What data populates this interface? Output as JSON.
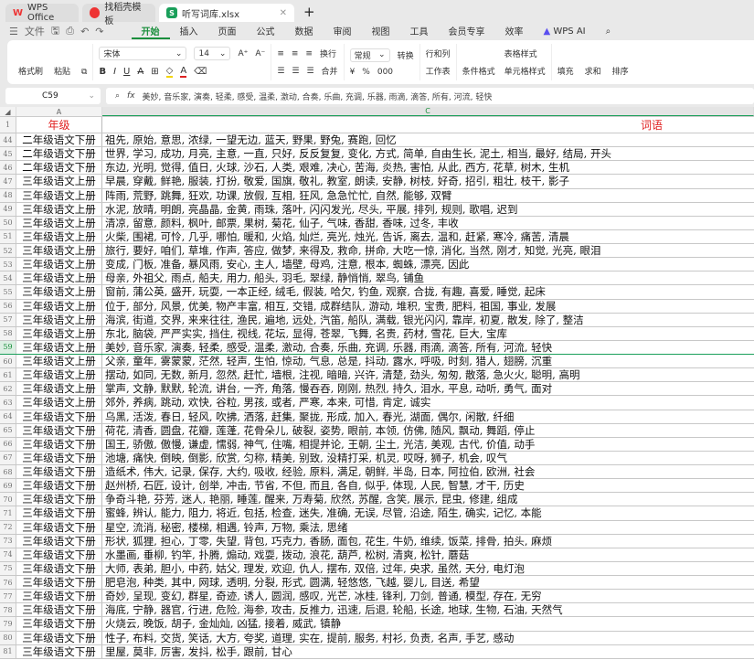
{
  "tabs": [
    {
      "label": "WPS Office",
      "icon": "wps-logo-icon"
    },
    {
      "label": "找稻壳模板",
      "icon": "docer-icon"
    },
    {
      "label": "听写词库.xlsx",
      "icon": "spreadsheet-icon"
    }
  ],
  "menu": {
    "file": "文件",
    "items": [
      "开始",
      "插入",
      "页面",
      "公式",
      "数据",
      "审阅",
      "视图",
      "工具",
      "会员专享",
      "效率"
    ],
    "active": "开始",
    "ai": "WPS AI"
  },
  "ribbon": {
    "format_painter": "格式刷",
    "paste": "粘贴",
    "font": "宋体",
    "font_size": "14",
    "wrap": "换行",
    "merge": "合并",
    "number_format": "常规",
    "convert": "转换",
    "rows_cols": "行和列",
    "worksheet": "工作表",
    "cond_format": "条件格式",
    "table_style": "表格样式",
    "cell_style": "单元格样式",
    "fill": "填充",
    "sum": "求和",
    "sort": "排序"
  },
  "formula_bar": {
    "cell_ref": "C59",
    "fx": "fx",
    "value": "美妙, 音乐家, 演奏, 轻柔, 感受, 温柔, 激动, 合奏, 乐曲, 充调, 乐器, 雨滴, 滴答, 所有, 河流, 轻快"
  },
  "columns": {
    "a": "A",
    "c": "C"
  },
  "header_row": {
    "num": "1",
    "a": "年级",
    "c": "词语"
  },
  "selected_row": "59",
  "colors": {
    "accent": "#1a8f3c",
    "header_text": "#e02020"
  },
  "rows": [
    {
      "n": "44",
      "a": "二年级语文下册",
      "c": "祖先, 原始, 意思, 浓绿, 一望无边, 蓝天, 野果, 野兔, 赛跑, 回忆"
    },
    {
      "n": "45",
      "a": "二年级语文下册",
      "c": "世界, 学习, 成功, 月亮, 主意, 一直, 只好, 反反复复, 变化, 方式, 简单, 自由生长, 泥土, 相当, 最好, 结局, 开头"
    },
    {
      "n": "46",
      "a": "二年级语文下册",
      "c": "东边, 光明, 觉得, 值日, 火球, 沙石, 人类, 艰难, 决心, 苦海, 炎热, 害怕, 从此, 西方, 花草, 树木, 生机"
    },
    {
      "n": "47",
      "a": "三年级语文上册",
      "c": "早晨, 穿戴, 鲜艳, 服装, 打扮, 敬爱, 国旗, 敬礼, 教室, 朗读, 安静, 树枝, 好奇, 招引, 粗壮, 枝干, 影子"
    },
    {
      "n": "48",
      "a": "三年级语文上册",
      "c": "阵雨, 荒野, 跳舞, 狂欢, 功课, 放假, 互相, 狂风, 急急忙忙, 自然, 能够, 双臂"
    },
    {
      "n": "49",
      "a": "三年级语文上册",
      "c": "水泥, 放晴, 明朗, 亮晶晶, 金黄, 雨珠, 落叶, 闪闪发光, 尽头, 平展, 排列, 规则, 歌唱, 迟到"
    },
    {
      "n": "50",
      "a": "三年级语文上册",
      "c": "清凉, 留意, 颜料, 枫叶, 邮票, 果树, 菊花, 仙子, 气味, 香甜, 香味, 过冬, 丰收"
    },
    {
      "n": "51",
      "a": "三年级语文上册",
      "c": "火柴, 围裙, 可怜, 几乎, 哪怕, 暖和, 火焰, 灿烂, 亮光, 烛光, 告诉, 离去, 温和, 赶紧, 寒冷, 痛苦, 清晨"
    },
    {
      "n": "52",
      "a": "三年级语文上册",
      "c": "旅行, 要好, 咱们, 草堆, 作声, 答应, 做梦, 来得及, 救命, 拼命, 大吃一惊, 消化, 当然, 刚才, 知觉, 光亮, 眼泪"
    },
    {
      "n": "53",
      "a": "三年级语文上册",
      "c": "变成, 门板, 准备, 暴风雨, 安心, 主人, 墙壁, 母鸡, 注意, 根本, 蜘蛛, 漂亮, 因此"
    },
    {
      "n": "54",
      "a": "三年级语文上册",
      "c": "母亲, 外祖父, 雨点, 船夫, 用力, 船头, 羽毛, 翠绿, 静悄悄, 翠鸟, 铺鱼"
    },
    {
      "n": "55",
      "a": "三年级语文上册",
      "c": "窗前, 蒲公英, 盛开, 玩耍, 一本正经, 绒毛, 假装, 哈欠, 钓鱼, 观察, 合拢, 有趣, 喜爱, 睡觉, 起床"
    },
    {
      "n": "56",
      "a": "三年级语文上册",
      "c": "位于, 部分, 风景, 优美, 物产丰富, 相互, 交错, 成群结队, 游动, 堆积, 宝贵, 肥料, 祖国, 事业, 发展"
    },
    {
      "n": "57",
      "a": "三年级语文上册",
      "c": "海滨, 街道, 交界, 来来往往, 渔民, 遍地, 远处, 汽笛, 船队, 满载, 银光闪闪, 靠岸, 初夏, 散发, 除了, 整洁"
    },
    {
      "n": "58",
      "a": "三年级语文上册",
      "c": "东北, 脑袋, 严严实实, 挡住, 视线, 花坛, 显得, 苍翠, 飞舞, 名贵, 药材, 雪花, 巨大, 宝库"
    },
    {
      "n": "59",
      "a": "三年级语文上册",
      "c": "美妙, 音乐家, 演奏, 轻柔, 感受, 温柔, 激动, 合奏, 乐曲, 充调, 乐器, 雨滴, 滴答, 所有, 河流, 轻快"
    },
    {
      "n": "60",
      "a": "三年级语文上册",
      "c": "父亲, 童年, 雾蒙蒙, 茫然, 轻声, 生怕, 惊动, 气息, 总是, 抖动, 露水, 呼吸, 时刻, 猎人, 翅膀, 沉重"
    },
    {
      "n": "61",
      "a": "三年级语文上册",
      "c": "摆动, 如同, 无数, 新月, 忽然, 赶忙, 墙根, 注视, 暗暗, 兴许, 清楚, 劲头, 匆匆, 散落, 急火火, 聪明, 高明"
    },
    {
      "n": "62",
      "a": "三年级语文上册",
      "c": "掌声, 文静, 默默, 轮流, 讲台, 一齐, 角落, 慢吞吞, 刚刚, 热烈, 持久, 泪水, 平息, 动听, 勇气, 面对"
    },
    {
      "n": "63",
      "a": "三年级语文上册",
      "c": "郊外, 养病, 跳动, 欢快, 谷粒, 男孩, 或者, 严寒, 本来, 可惜, 肯定, 诚实"
    },
    {
      "n": "64",
      "a": "三年级语文下册",
      "c": "乌黑, 活泼, 春日, 轻风, 吹拂, 洒落, 赶集, 聚拢, 形成, 加入, 春光, 湖面, 偶尔, 闲散, 纤细"
    },
    {
      "n": "65",
      "a": "三年级语文下册",
      "c": "荷花, 清香, 圆盘, 花瓣, 莲蓬, 花骨朵儿, 破裂, 姿势, 眼前, 本领, 仿佛, 随风, 飘动, 舞蹈, 停止"
    },
    {
      "n": "66",
      "a": "三年级语文下册",
      "c": "国王, 骄傲, 傲慢, 谦虚, 懦弱, 神气, 住嘴, 相提并论, 王朝, 尘土, 光洁, 美观, 古代, 价值, 动手"
    },
    {
      "n": "67",
      "a": "三年级语文下册",
      "c": "池塘, 痛快, 倒映, 倒影, 欣赏, 匀称, 精美, 别致, 没精打采, 机灵, 哎呀, 狮子, 机会, 叹气"
    },
    {
      "n": "68",
      "a": "三年级语文下册",
      "c": "造纸术, 伟大, 记录, 保存, 大约, 吸收, 经验, 原料, 满足, 朝鲜, 半岛, 日本, 阿拉伯, 欧洲, 社会"
    },
    {
      "n": "69",
      "a": "三年级语文下册",
      "c": "赵州桥, 石匠, 设计, 创举, 冲击, 节省, 不但, 而且, 各自, 似乎, 体现, 人民, 智慧, 才干, 历史"
    },
    {
      "n": "70",
      "a": "三年级语文下册",
      "c": "争奇斗艳, 芬芳, 迷人, 艳丽, 睡莲, 醒来, 万寿菊, 欣然, 苏醒, 含笑, 展示, 昆虫, 修建, 组成"
    },
    {
      "n": "71",
      "a": "三年级语文下册",
      "c": "蜜蜂, 辨认, 能力, 阻力, 将近, 包括, 检查, 迷失, 准确, 无误, 尽管, 沿途, 陌生, 确实, 记忆, 本能"
    },
    {
      "n": "72",
      "a": "三年级语文下册",
      "c": "星空, 流消, 秘密, 楼梯, 相遇, 铃声, 万物, 乘法, 思绪"
    },
    {
      "n": "73",
      "a": "三年级语文下册",
      "c": "形状, 狐狸, 担心, 丁零, 失望, 背包, 巧克力, 香肠, 面包, 花生, 牛奶, 维续, 饭菜, 排骨, 拍头, 麻烦"
    },
    {
      "n": "74",
      "a": "三年级语文下册",
      "c": "水墨画, 垂柳, 钓竿, 扑腾, 煽动, 戏耍, 拨动, 浪花, 葫芦, 松树, 清爽, 松针, 蘑菇"
    },
    {
      "n": "75",
      "a": "三年级语文下册",
      "c": "大师, 表弟, 胆小, 中药, 姑父, 理发, 欢迎, 仇人, 摆布, 双倍, 过年, 央求, 虽然, 天分, 电灯泡"
    },
    {
      "n": "76",
      "a": "三年级语文下册",
      "c": "肥皂泡, 种类, 其中, 网球, 透明, 分裂, 形式, 圆满, 轻悠悠, 飞越, 婴儿, 目送, 希望"
    },
    {
      "n": "77",
      "a": "三年级语文下册",
      "c": "奇妙, 呈现, 变幻, 群星, 奇迹, 诱人, 圆润, 感叹, 光芒, 冰桂, 锋利, 刀剑, 普通, 模型, 存在, 无穷"
    },
    {
      "n": "78",
      "a": "三年级语文下册",
      "c": "海底, 宁静, 器官, 行进, 危险, 海参, 攻击, 反推力, 迅速, 后退, 轮船, 长途, 地球, 生物, 石油, 天然气"
    },
    {
      "n": "79",
      "a": "三年级语文下册",
      "c": "火烧云, 晚饭, 胡子, 金灿灿, 凶猛, 接着, 威武, 镇静"
    },
    {
      "n": "80",
      "a": "三年级语文下册",
      "c": "性子, 布料, 交货, 笑话, 大方, 夸奖, 道理, 实在, 提前, 服务, 村衫, 负责, 名声, 手艺, 感动"
    },
    {
      "n": "81",
      "a": "三年级语文下册",
      "c": "里屋, 莫非, 厉害, 发抖, 松手, 跟前, 甘心"
    }
  ]
}
